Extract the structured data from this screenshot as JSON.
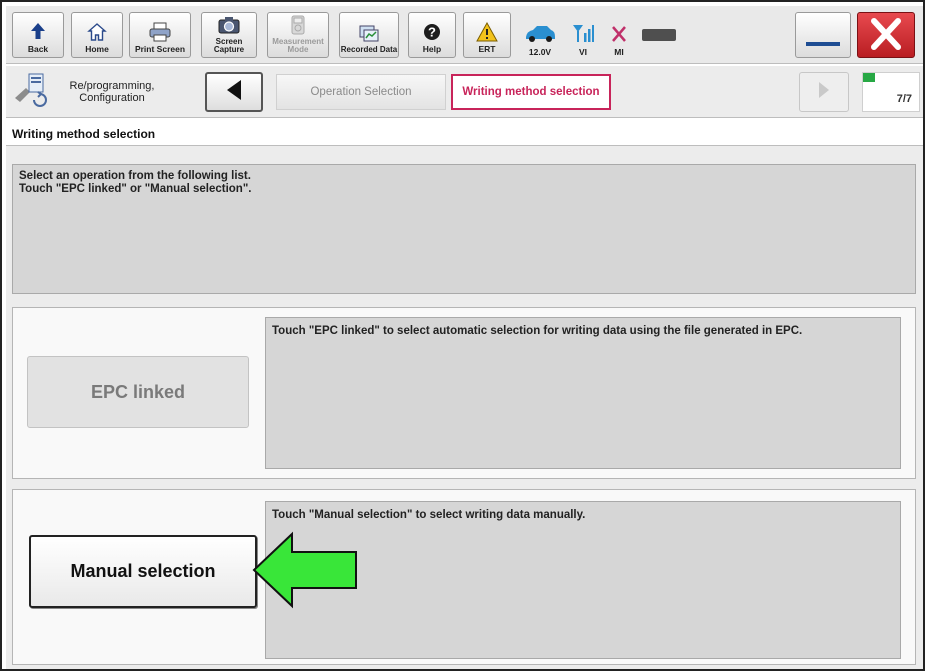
{
  "toolbar": {
    "buttons": [
      {
        "label": "Back",
        "icon": "back-arrow-icon",
        "enabled": true
      },
      {
        "label": "Home",
        "icon": "home-icon",
        "enabled": true
      },
      {
        "label": "Print Screen",
        "icon": "printer-icon",
        "enabled": true
      },
      {
        "label": "Screen Capture",
        "icon": "camera-icon",
        "enabled": true
      },
      {
        "label": "Measurement Mode",
        "icon": "meter-icon",
        "enabled": false
      },
      {
        "label": "Recorded Data",
        "icon": "recorded-data-icon",
        "enabled": true
      },
      {
        "label": "Help",
        "icon": "help-icon",
        "enabled": true
      },
      {
        "label": "ERT",
        "icon": "warning-icon",
        "enabled": true
      }
    ],
    "status": {
      "battery_voltage": "12.0V",
      "vi_label": "VI",
      "mi_label": "MI"
    }
  },
  "nav": {
    "section_label": "Re/programming, Configuration",
    "steps": [
      "Operation Selection",
      "Writing method selection"
    ],
    "progress_text": "7/7",
    "progress_fraction": 0.22
  },
  "screen": {
    "title": "Writing method selection",
    "instructions": [
      "Select an operation from the following list.",
      "Touch \"EPC linked\" or \"Manual selection\"."
    ],
    "options": [
      {
        "label": "EPC linked",
        "enabled": false,
        "description": "Touch \"EPC linked\" to select automatic selection for writing data using the file generated in EPC."
      },
      {
        "label": "Manual selection",
        "enabled": true,
        "description": "Touch \"Manual selection\" to select writing data manually."
      }
    ]
  },
  "colors": {
    "active_step": "#c8245a",
    "progress": "#27a844",
    "close_red": "#d9262b",
    "pointer_arrow": "#39e639"
  }
}
